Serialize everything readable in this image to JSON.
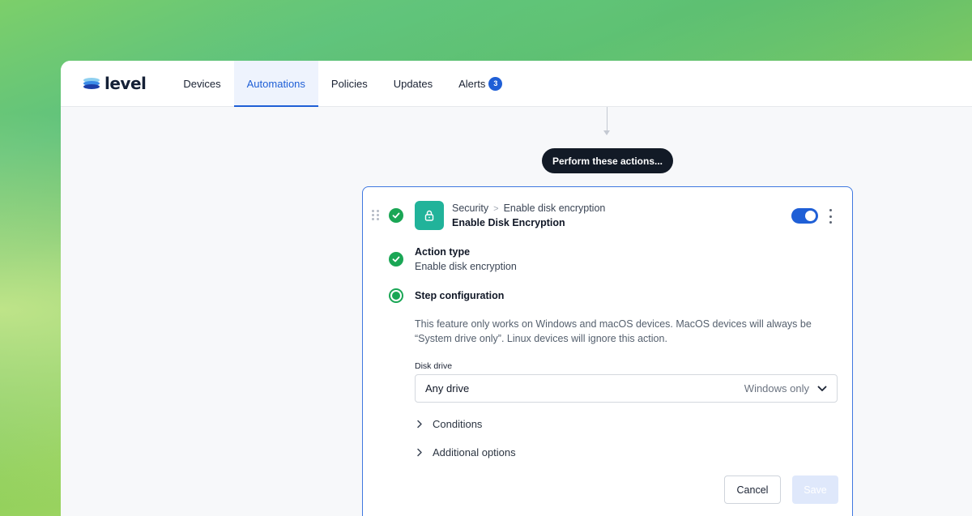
{
  "brand": {
    "name": "level"
  },
  "nav": {
    "items": [
      {
        "label": "Devices"
      },
      {
        "label": "Automations"
      },
      {
        "label": "Policies"
      },
      {
        "label": "Updates"
      },
      {
        "label": "Alerts",
        "badge": "3"
      }
    ],
    "active": "Automations"
  },
  "flow": {
    "pill_label": "Perform these actions..."
  },
  "card": {
    "breadcrumb": {
      "category": "Security",
      "item": "Enable disk encryption"
    },
    "title": "Enable Disk Encryption",
    "enabled": true,
    "steps": {
      "action_type": {
        "label": "Action type",
        "value": "Enable disk encryption"
      },
      "configuration": {
        "label": "Step configuration"
      }
    },
    "description": "This feature only works on Windows and macOS devices. MacOS devices will always be “System drive only”. Linux devices will ignore this action.",
    "disk_drive": {
      "label": "Disk drive",
      "value": "Any drive",
      "hint": "Windows only"
    },
    "expanders": {
      "conditions": "Conditions",
      "additional": "Additional options"
    },
    "buttons": {
      "cancel": "Cancel",
      "save": "Save"
    }
  },
  "colors": {
    "accent": "#1f5fd6",
    "success": "#1aa655",
    "security_tile": "#21b39a",
    "pill": "#121a26"
  }
}
